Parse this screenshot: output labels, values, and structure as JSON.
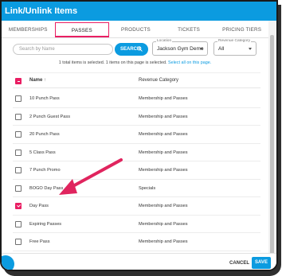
{
  "dialog": {
    "title": "Link/Unlink Items"
  },
  "tabs": [
    {
      "label": "MEMBERSHIPS"
    },
    {
      "label": "PASSES"
    },
    {
      "label": "PRODUCTS"
    },
    {
      "label": "TICKETS"
    },
    {
      "label": "PRICING TIERS"
    }
  ],
  "search": {
    "placeholder": "Search by Name",
    "button_label": "SEARCH"
  },
  "filters": {
    "location": {
      "label": "Location",
      "value": "Jackson Gym Demo"
    },
    "revenue_category": {
      "label": "Revenue Category",
      "value": "All"
    }
  },
  "selection_info": {
    "text": "1 total items is selected. 1 items on this page is selected.",
    "link": "Select all on this page."
  },
  "table": {
    "col_name": "Name",
    "sort_icon": "arrow-up-icon",
    "col_category": "Revenue Category",
    "rows": [
      {
        "name": "10 Punch Pass",
        "category": "Membership and Passes",
        "checked": false
      },
      {
        "name": "2 Punch Guest Pass",
        "category": "Membership and Passes",
        "checked": false
      },
      {
        "name": "20 Punch Pass",
        "category": "Membership and Passes",
        "checked": false
      },
      {
        "name": "5 Class Pass",
        "category": "Membership and Passes",
        "checked": false
      },
      {
        "name": "7 Punch Promo",
        "category": "Membership and Passes",
        "checked": false
      },
      {
        "name": "BOGO Day Pass",
        "category": "Specials",
        "checked": false
      },
      {
        "name": "Day Pass",
        "category": "Membership and Passes",
        "checked": true
      },
      {
        "name": "Expiring Passes",
        "category": "Membership and Passes",
        "checked": false
      },
      {
        "name": "Free Pass",
        "category": "Membership and Passes",
        "checked": false
      }
    ]
  },
  "footer": {
    "cancel_label": "CANCEL",
    "save_label": "SAVE"
  },
  "colors": {
    "primary": "#0b9be0",
    "accent": "#e91e63"
  }
}
